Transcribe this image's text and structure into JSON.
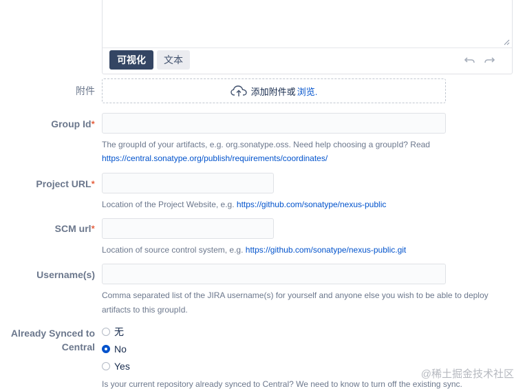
{
  "editor": {
    "tab_visual": "可视化",
    "tab_text": "文本"
  },
  "attachment": {
    "label": "附件",
    "text": "添加附件或",
    "browse": "浏览."
  },
  "fields": {
    "group_id": {
      "label": "Group Id",
      "required": "*",
      "help_text": "The groupId of your artifacts, e.g. org.sonatype.oss. Need help choosing a groupId? Read",
      "help_link": "https://central.sonatype.org/publish/requirements/coordinates/"
    },
    "project_url": {
      "label": "Project URL",
      "required": "*",
      "help_text": "Location of the Project Website, e.g.",
      "help_link": "https://github.com/sonatype/nexus-public"
    },
    "scm_url": {
      "label": "SCM url",
      "required": "*",
      "help_text": "Location of source control system, e.g.",
      "help_link": "https://github.com/sonatype/nexus-public.git"
    },
    "usernames": {
      "label": "Username(s)",
      "help_line1": "Comma separated list of the JIRA username(s) for yourself and anyone else you wish to be able to deploy",
      "help_line2": "artifacts to this groupId."
    },
    "already_synced": {
      "label_line1": "Already Synced to",
      "label_line2": "Central",
      "options": [
        "无",
        "No",
        "Yes"
      ],
      "selected": "No",
      "help_text": "Is your current repository already synced to Central? We need to know to turn off the existing sync."
    }
  },
  "watermark": "@稀土掘金技术社区",
  "colors": {
    "accent": "#0052cc",
    "required": "#de350b",
    "tab_active": "#344563"
  },
  "icons": {
    "undo": "undo-icon",
    "redo": "redo-icon",
    "upload": "cloud-upload-icon"
  }
}
